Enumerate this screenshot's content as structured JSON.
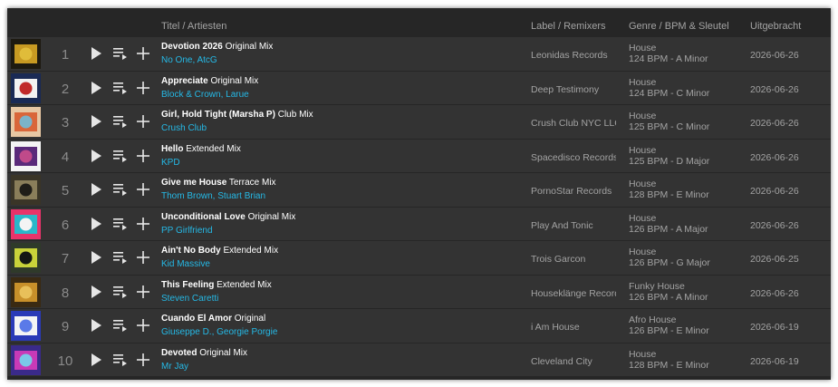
{
  "header": {
    "title_artists": "Titel / Artiesten",
    "label_remixers": "Label / Remixers",
    "genre_bpm_key": "Genre / BPM & Sleutel",
    "released": "Uitgebracht"
  },
  "tracks": [
    {
      "num": "1",
      "title": "Devotion 2026",
      "mix": "Original Mix",
      "artists": "No One, AtcG",
      "label": "Leonidas Records",
      "genre": "House",
      "bpm_key": "124 BPM - A Minor",
      "date": "2026-06-26",
      "art_colors": [
        "#1d1a10",
        "#c79a22",
        "#e0bc3a"
      ]
    },
    {
      "num": "2",
      "title": "Appreciate",
      "mix": "Original Mix",
      "artists": "Block & Crown, Larue",
      "label": "Deep Testimony",
      "genre": "House",
      "bpm_key": "124 BPM - C Minor",
      "date": "2026-06-26",
      "art_colors": [
        "#1a2a55",
        "#f2f2f2",
        "#c12a2a"
      ]
    },
    {
      "num": "3",
      "title": "Girl, Hold Tight (Marsha P)",
      "mix": "Club Mix",
      "artists": "Crush Club",
      "label": "Crush Club NYC LLC",
      "genre": "House",
      "bpm_key": "125 BPM - C Minor",
      "date": "2026-06-26",
      "art_colors": [
        "#e7c7a3",
        "#d9663a",
        "#7cb3c9"
      ]
    },
    {
      "num": "4",
      "title": "Hello",
      "mix": "Extended Mix",
      "artists": "KPD",
      "label": "Spacedisco Records",
      "genre": "House",
      "bpm_key": "125 BPM - D Major",
      "date": "2026-06-26",
      "art_colors": [
        "#f4f4f4",
        "#5a2a7a",
        "#c04a8a"
      ]
    },
    {
      "num": "5",
      "title": "Give me House",
      "mix": "Terrace Mix",
      "artists": "Thom Brown, Stuart Brian",
      "label": "PornoStar Records",
      "genre": "House",
      "bpm_key": "128 BPM - E Minor",
      "date": "2026-06-26",
      "art_colors": [
        "#3a3527",
        "#8a7e5a",
        "#1f1d18"
      ]
    },
    {
      "num": "6",
      "title": "Unconditional Love",
      "mix": "Original Mix",
      "artists": "PP Girlfriend",
      "label": "Play And Tonic",
      "genre": "House",
      "bpm_key": "126 BPM - A Major",
      "date": "2026-06-26",
      "art_colors": [
        "#e8336a",
        "#2ab7c9",
        "#f4f4f4"
      ]
    },
    {
      "num": "7",
      "title": "Ain't No Body",
      "mix": "Extended Mix",
      "artists": "Kid Massive",
      "label": "Trois Garcon",
      "genre": "House",
      "bpm_key": "126 BPM - G Major",
      "date": "2026-06-25",
      "art_colors": [
        "#2f3a2a",
        "#c8d23a",
        "#141814"
      ]
    },
    {
      "num": "8",
      "title": "This Feeling",
      "mix": "Extended Mix",
      "artists": "Steven Caretti",
      "label": "Houseklänge Records",
      "genre": "Funky House",
      "bpm_key": "126 BPM - A Minor",
      "date": "2026-06-26",
      "art_colors": [
        "#3a2a12",
        "#c8902a",
        "#e8c05a"
      ]
    },
    {
      "num": "9",
      "title": "Cuando El Amor",
      "mix": "Original",
      "artists": "Giuseppe D., Georgie Porgie",
      "label": "i Am House",
      "genre": "Afro House",
      "bpm_key": "126 BPM - E Minor",
      "date": "2026-06-19",
      "art_colors": [
        "#2a3ab7",
        "#f4f4f4",
        "#5a7ae8"
      ]
    },
    {
      "num": "10",
      "title": "Devoted",
      "mix": "Original Mix",
      "artists": "Mr Jay",
      "label": "Cleveland City",
      "genre": "House",
      "bpm_key": "128 BPM - E Minor",
      "date": "2026-06-19",
      "art_colors": [
        "#3a2a8a",
        "#c83ab7",
        "#7ac8e8"
      ]
    }
  ]
}
